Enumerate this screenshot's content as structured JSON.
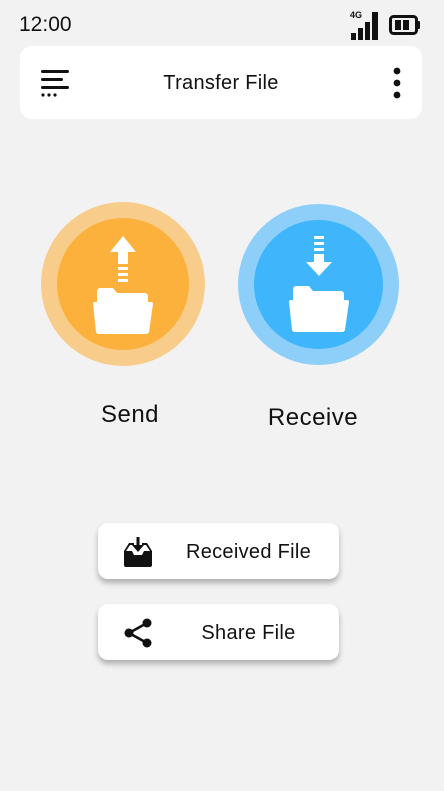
{
  "status_bar": {
    "time": "12:00",
    "network_label": "4G",
    "signal_icon": "signal-bars-icon",
    "battery_icon": "battery-icon"
  },
  "header": {
    "title": "Transfer File",
    "menu_icon": "menu-icon",
    "more_icon": "more-vertical-icon"
  },
  "actions": {
    "send": {
      "label": "Send",
      "icon": "folder-upload-icon",
      "color": "#fbb13c",
      "ring_color": "#f8cd8b"
    },
    "receive": {
      "label": "Receive",
      "icon": "folder-download-icon",
      "color": "#3fb5fc",
      "ring_color": "#8ecffa"
    }
  },
  "buttons": {
    "received_file": {
      "label": "Received File",
      "icon": "inbox-download-icon"
    },
    "share_file": {
      "label": "Share File",
      "icon": "share-icon"
    }
  }
}
